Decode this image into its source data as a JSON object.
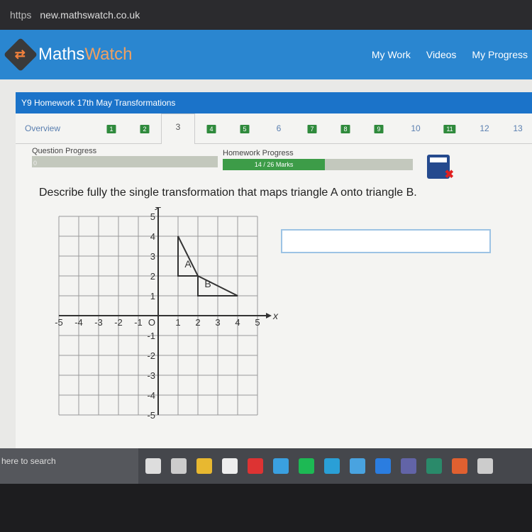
{
  "browser": {
    "protocol": "https",
    "url": "new.mathswatch.co.uk"
  },
  "header": {
    "brand_a": "Maths",
    "brand_b": "Watch",
    "nav": [
      "My Work",
      "Videos",
      "My Progress"
    ]
  },
  "homework": {
    "title": "Y9 Homework 17th May Transformations"
  },
  "tabs": [
    {
      "label": "Overview",
      "state": "link"
    },
    {
      "label": "1",
      "state": "done"
    },
    {
      "label": "2",
      "state": "done"
    },
    {
      "label": "3",
      "state": "active"
    },
    {
      "label": "4",
      "state": "done"
    },
    {
      "label": "5",
      "state": "done"
    },
    {
      "label": "6",
      "state": "link"
    },
    {
      "label": "7",
      "state": "done"
    },
    {
      "label": "8",
      "state": "done"
    },
    {
      "label": "9",
      "state": "done"
    },
    {
      "label": "10",
      "state": "link"
    },
    {
      "label": "11",
      "state": "done"
    },
    {
      "label": "12",
      "state": "link"
    },
    {
      "label": "13",
      "state": "link"
    }
  ],
  "progress": {
    "question_label": "Question Progress",
    "question_value": "0",
    "homework_label": "Homework Progress",
    "homework_text": "14 / 26 Marks",
    "homework_fraction": 0.538
  },
  "question": {
    "text": "Describe fully the single transformation that maps triangle A onto triangle B.",
    "answer_value": ""
  },
  "graph": {
    "xlabel": "x",
    "ylabel": "y",
    "origin_label": "O",
    "range": [
      -5,
      5
    ],
    "triangles": [
      {
        "label": "A",
        "points": [
          [
            1,
            2
          ],
          [
            1,
            4
          ],
          [
            2,
            2
          ]
        ]
      },
      {
        "label": "B",
        "points": [
          [
            2,
            1
          ],
          [
            2,
            2
          ],
          [
            4,
            1
          ]
        ]
      }
    ]
  },
  "taskbar": {
    "search_placeholder": "here to search",
    "icons": [
      "cortana-icon",
      "task-view-icon",
      "file-explorer-icon",
      "store-icon",
      "gift-icon",
      "mail-icon",
      "spotify-icon",
      "edge-icon",
      "bulb-icon",
      "app-icon",
      "teams-icon",
      "publisher-icon",
      "origin-icon",
      "settings-icon"
    ]
  },
  "colors": {
    "brand": "#2a86d0",
    "done": "#2f8a3c",
    "title": "#1b73c9"
  }
}
